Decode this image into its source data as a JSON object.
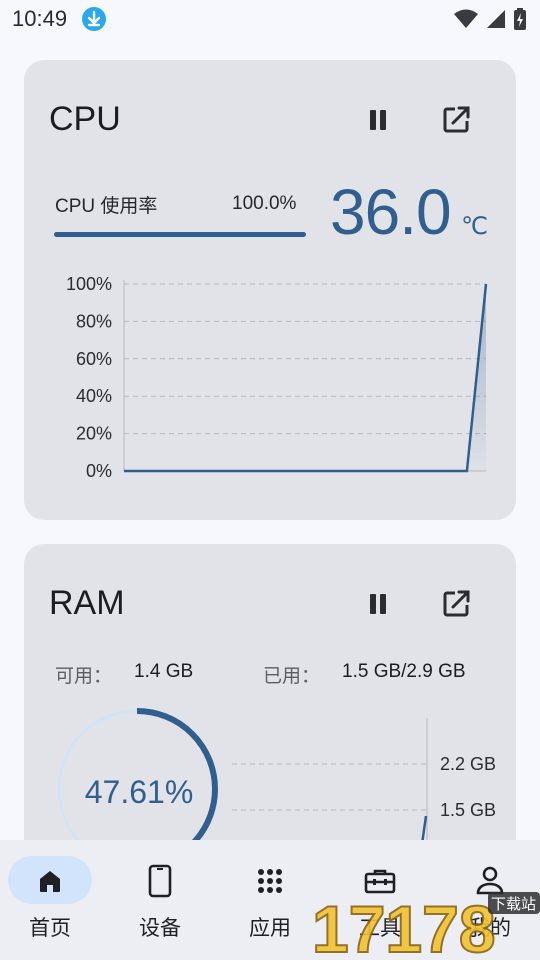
{
  "status": {
    "time": "10:49"
  },
  "cpu": {
    "title": "CPU",
    "usage_label": "CPU 使用率",
    "usage_value": "100.0%",
    "usage_fraction": 1.0,
    "temperature": "36.0",
    "temp_unit": "℃"
  },
  "ram": {
    "title": "RAM",
    "available_label": "可用：",
    "available_value": "1.4 GB",
    "used_label": "已用：",
    "used_value": "1.5 GB/2.9 GB",
    "percent": "47.61%",
    "percent_fraction": 0.4761
  },
  "chart_data": [
    {
      "type": "area",
      "y_ticks": [
        "100%",
        "80%",
        "60%",
        "40%",
        "20%",
        "0%"
      ],
      "ylim": [
        0,
        100
      ],
      "grid": true,
      "series": [
        {
          "values": [
            0,
            0,
            0,
            0,
            0,
            0,
            0,
            0,
            0,
            0,
            0,
            0,
            0,
            0,
            0,
            0,
            0,
            0,
            0,
            100
          ]
        }
      ]
    },
    {
      "type": "line",
      "y_ticks": [
        "2.2 GB",
        "1.5 GB"
      ],
      "grid": true
    }
  ],
  "nav": {
    "items": [
      {
        "label": "首页",
        "icon": "home-icon",
        "active": true
      },
      {
        "label": "设备",
        "icon": "phone-icon",
        "active": false
      },
      {
        "label": "应用",
        "icon": "apps-grid-icon",
        "active": false
      },
      {
        "label": "工具",
        "icon": "toolbox-icon",
        "active": false
      },
      {
        "label": "我的",
        "icon": "person-icon",
        "active": false
      }
    ]
  },
  "watermark": {
    "text": "17178",
    "tag": "下载站"
  },
  "colors": {
    "accent": "#305f8f",
    "card": "#e2e3e8",
    "background": "#f7f8fe",
    "nav_active": "#d2e4fb"
  }
}
